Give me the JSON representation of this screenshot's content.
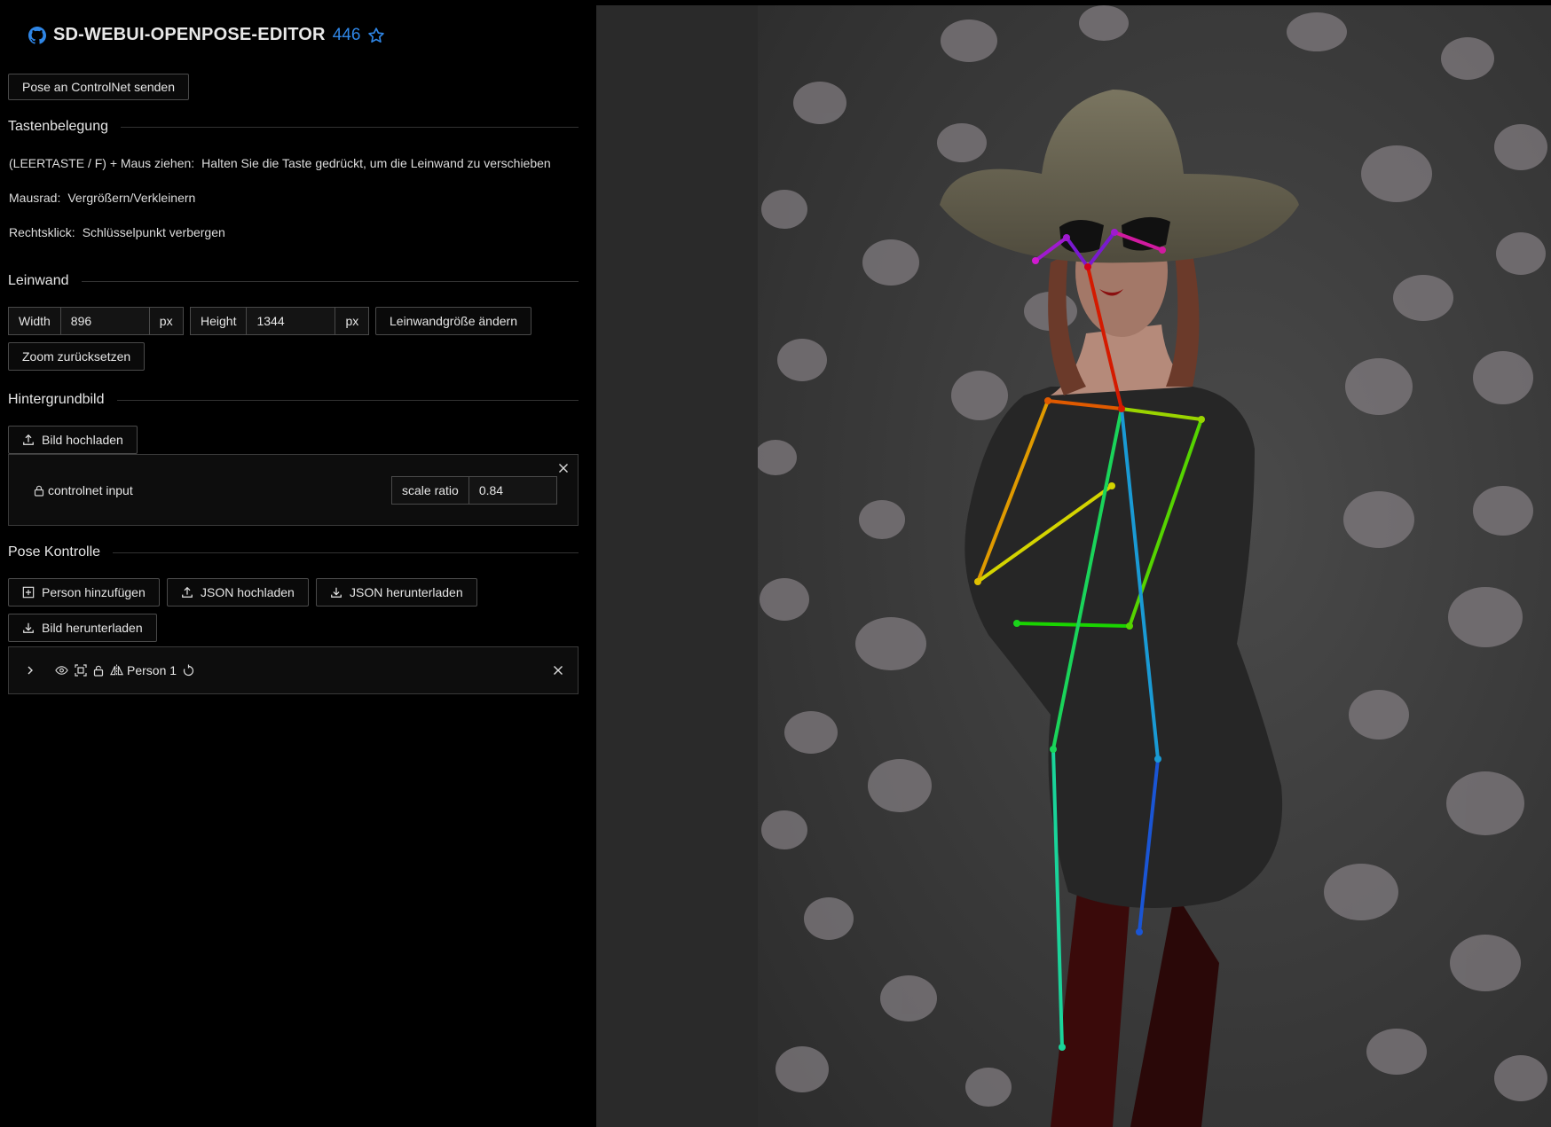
{
  "header": {
    "title": "SD-WEBUI-OPENPOSE-EDITOR",
    "stars": "446"
  },
  "send_button": "Pose an ControlNet senden",
  "keybindings": {
    "title": "Tastenbelegung",
    "items": [
      {
        "key": "(LEERTASTE / F) + Maus ziehen:",
        "desc": "Halten Sie die Taste gedrückt, um die Leinwand zu verschieben"
      },
      {
        "key": "Mausrad:",
        "desc": "Vergrößern/Verkleinern"
      },
      {
        "key": "Rechtsklick:",
        "desc": "Schlüsselpunkt verbergen"
      }
    ]
  },
  "canvas": {
    "title": "Leinwand",
    "width_label": "Width",
    "width_value": "896",
    "width_unit": "px",
    "height_label": "Height",
    "height_value": "1344",
    "height_unit": "px",
    "resize_button": "Leinwandgröße ändern",
    "reset_zoom_button": "Zoom zurücksetzen"
  },
  "background": {
    "title": "Hintergrundbild",
    "upload_button": "Bild hochladen",
    "item_label": "controlnet input",
    "scale_label": "scale ratio",
    "scale_value": "0.84"
  },
  "pose": {
    "title": "Pose Kontrolle",
    "add_person_button": "Person hinzufügen",
    "upload_json_button": "JSON hochladen",
    "download_json_button": "JSON herunterladen",
    "download_image_button": "Bild herunterladen",
    "person_label": "Person 1"
  },
  "colors": {
    "accent": "#2f86e6",
    "background": "#000000",
    "canvas": "#2b2b2b",
    "border": "#4a4a4a"
  }
}
